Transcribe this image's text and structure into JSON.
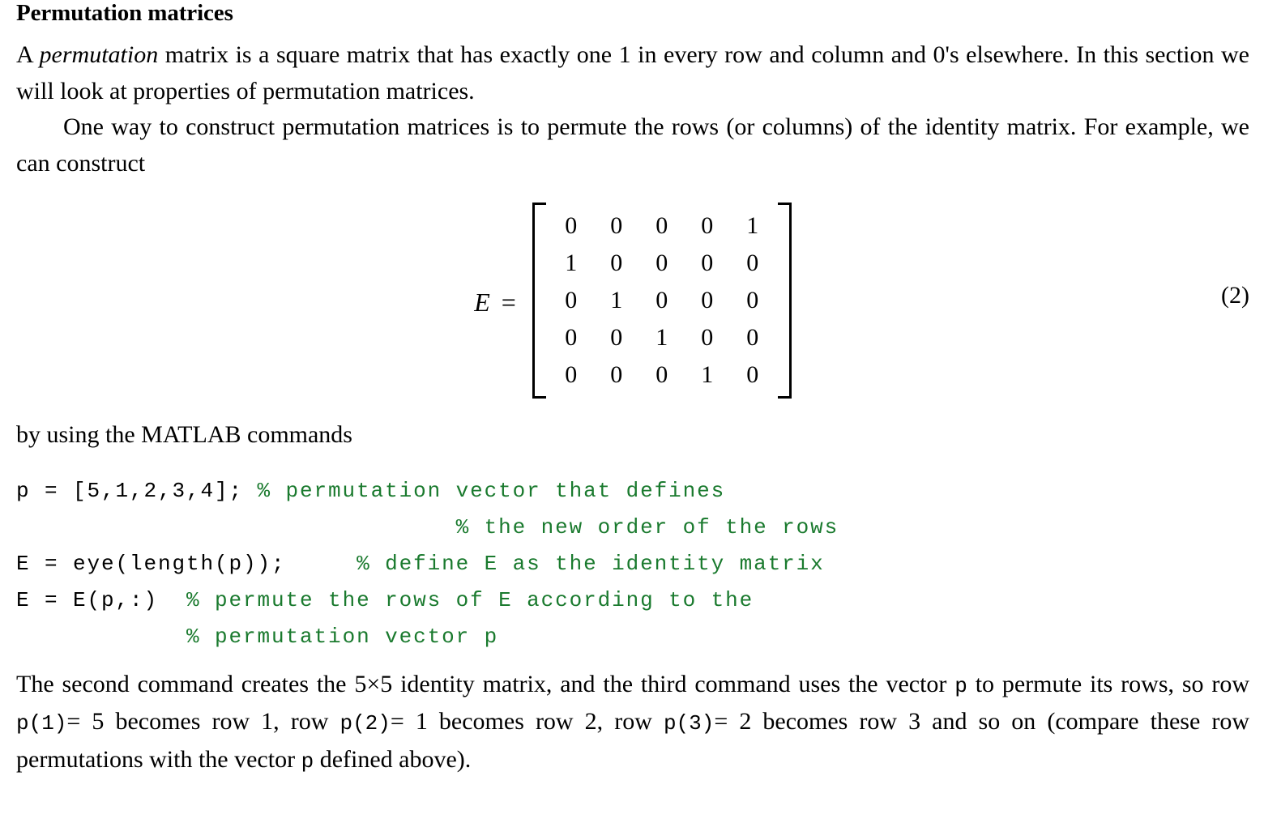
{
  "document": {
    "title": "Permutation matrices",
    "paragraphs": {
      "intro_line1_pre": "A ",
      "intro_emph": "permutation",
      "intro_line1_post": " matrix is a square matrix that has exactly one 1 in every row and column and 0's elsewhere. In this section we will look at properties of permutation matrices.",
      "intro_second": "One way to construct permutation matrices is to permute the rows (or columns) of the identity matrix. For example, we can construct",
      "after_equation": "by using the MATLAB commands"
    },
    "equation": {
      "label": "E",
      "relation": "=",
      "number": "(2)",
      "matrix": [
        [
          "0",
          "0",
          "0",
          "0",
          "1"
        ],
        [
          "1",
          "0",
          "0",
          "0",
          "0"
        ],
        [
          "0",
          "1",
          "0",
          "0",
          "0"
        ],
        [
          "0",
          "0",
          "1",
          "0",
          "0"
        ],
        [
          "0",
          "0",
          "0",
          "1",
          "0"
        ]
      ]
    },
    "code": {
      "comment_color": "#1a7a2e",
      "lines": [
        {
          "code": "p = [5,1,2,3,4]; ",
          "comment": "% permutation vector that defines"
        },
        {
          "code": "                 ",
          "comment": "              % the new order of the rows"
        },
        {
          "code": "E = eye(length(p));",
          "comment": "     % define E as the identity matrix"
        },
        {
          "code": "E = E(p,:)",
          "comment": "  % permute the rows of E according to the"
        },
        {
          "code": "          ",
          "comment": "  % permutation vector p"
        }
      ]
    },
    "closing": {
      "s1": "The second command creates the ",
      "dim": "5×5",
      "s2": " identity matrix, and the third command uses the vector ",
      "p1": "p",
      "s3": " to permute its rows, so row ",
      "p2": "p(1)",
      "eq1": "= 5",
      "s4": " becomes row 1, row ",
      "p3": "p(2)",
      "eq2": "= 1",
      "s5": " becomes row 2, row ",
      "p4": "p(3)",
      "eq3": "= 2",
      "s6": " becomes row 3 and so on (compare these row permutations with the vector ",
      "p5": "p",
      "s7": " defined above)."
    }
  }
}
